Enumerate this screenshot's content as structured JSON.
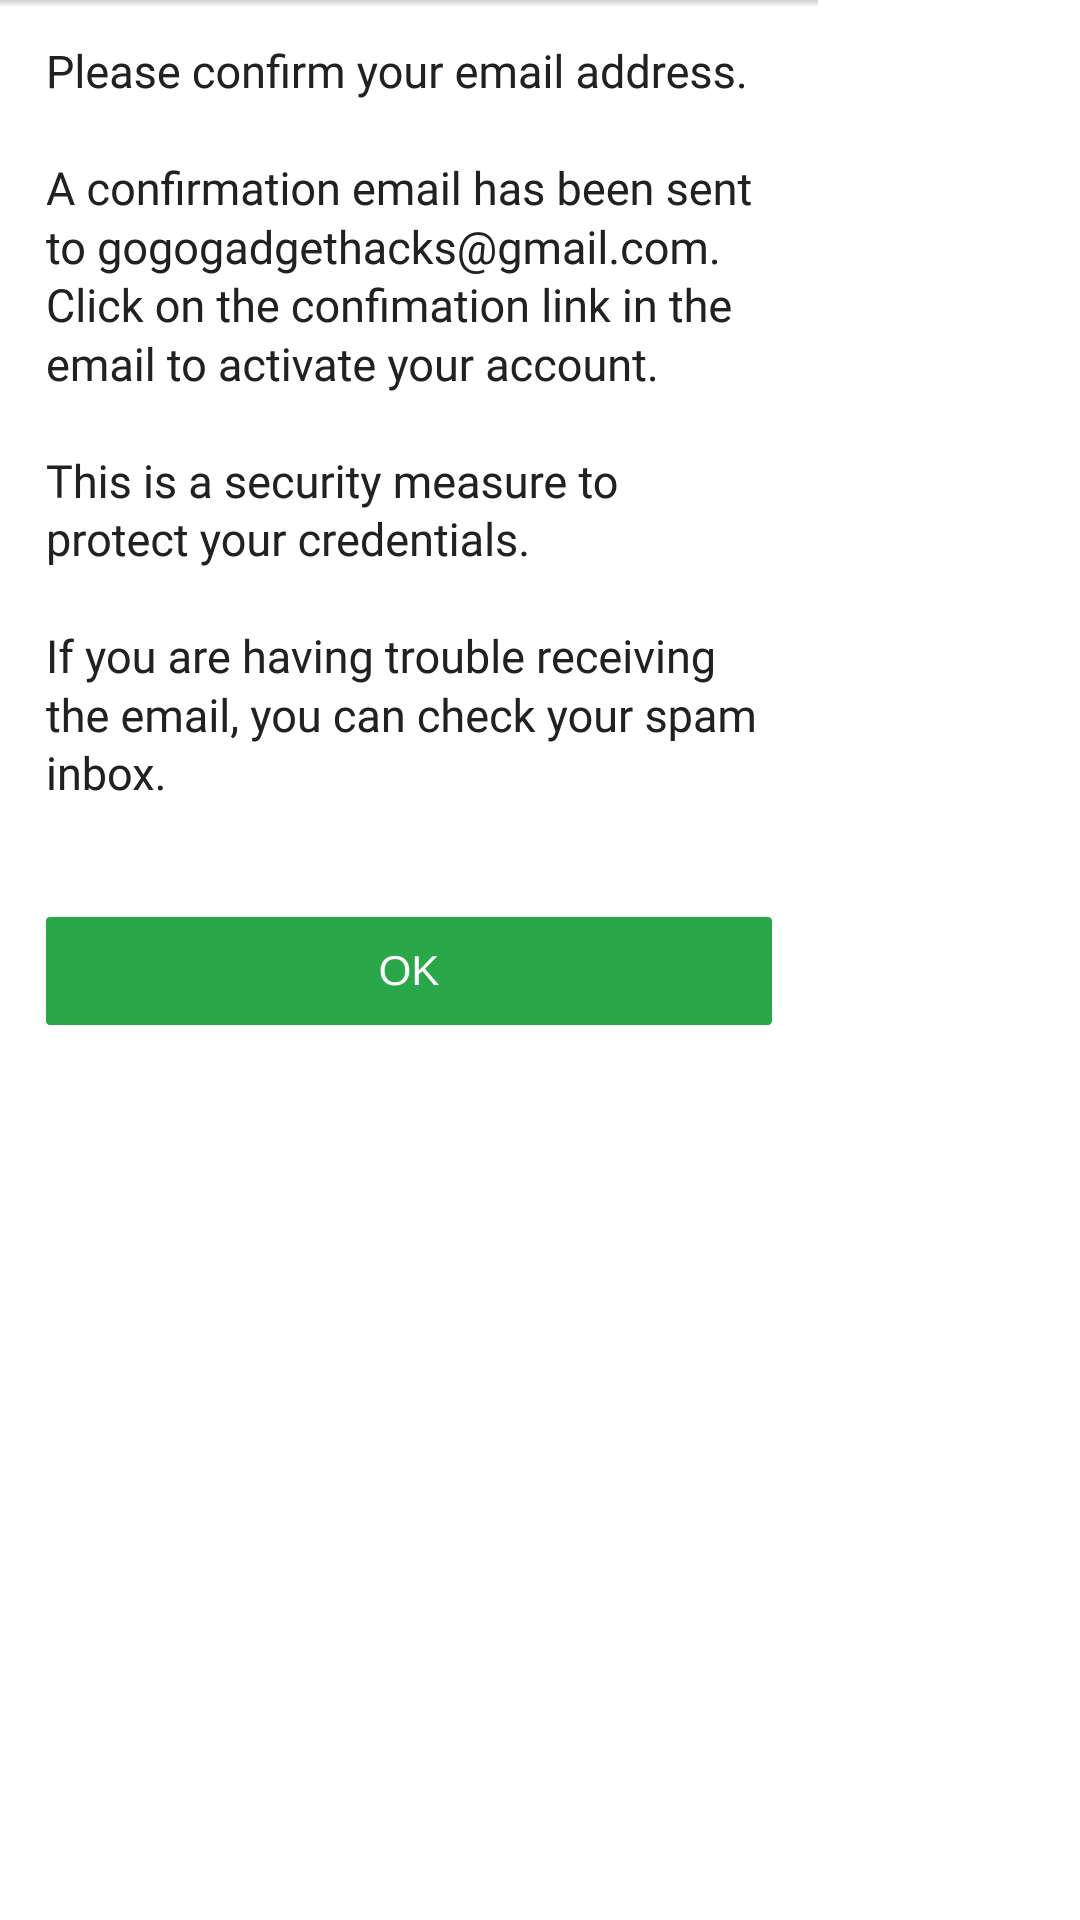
{
  "dialog": {
    "paragraph1": "Please confirm your email address.",
    "paragraph2": "A confirmation email has been sent to gogogadgethacks@gmail.com. Click on the confimation link in the email to activate your account.",
    "paragraph3": "This is a security measure to protect your credentials.",
    "paragraph4": "If you are having trouble receiving the email, you can check your spam inbox.",
    "ok_label": "OK"
  },
  "colors": {
    "button_bg": "#2aa748",
    "button_text": "#ffffff",
    "body_text": "#212121"
  }
}
